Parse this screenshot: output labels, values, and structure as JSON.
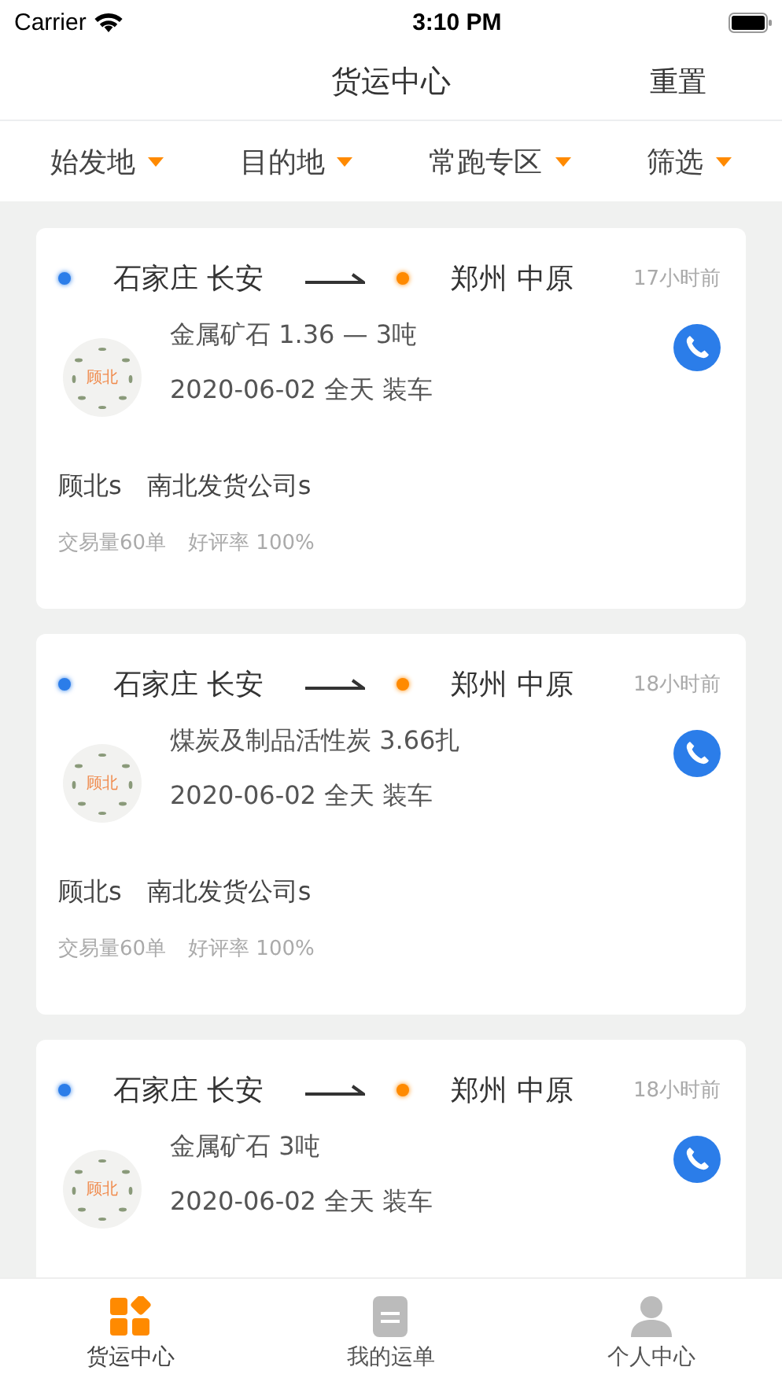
{
  "status_bar": {
    "carrier": "Carrier",
    "time": "3:10 PM"
  },
  "nav": {
    "title": "货运中心",
    "action": "重置"
  },
  "filters": [
    {
      "label": "始发地"
    },
    {
      "label": "目的地"
    },
    {
      "label": "常跑专区"
    },
    {
      "label": "筛选"
    }
  ],
  "cards": [
    {
      "origin": "石家庄 长安",
      "destination": "郑州 中原",
      "time": "17小时前",
      "logo": "顾北",
      "goods": "金属矿石 1.36 — 3吨",
      "loading": "2020-06-02 全天 装车",
      "company": "顾北s　南北发货公司s",
      "stats": [
        "交易量60单",
        "好评率 100%"
      ]
    },
    {
      "origin": "石家庄 长安",
      "destination": "郑州 中原",
      "time": "18小时前",
      "logo": "顾北",
      "goods": "煤炭及制品活性炭  3.66扎",
      "loading": "2020-06-02 全天 装车",
      "company": "顾北s　南北发货公司s",
      "stats": [
        "交易量60单",
        "好评率 100%"
      ]
    },
    {
      "origin": "石家庄 长安",
      "destination": "郑州 中原",
      "time": "18小时前",
      "logo": "顾北",
      "goods": "金属矿石  3吨",
      "loading": "2020-06-02 全天 装车"
    }
  ],
  "tab_bar": [
    {
      "label": "货运中心",
      "kind": "grid",
      "selected": true
    },
    {
      "label": "我的运单",
      "kind": "document",
      "selected": false
    },
    {
      "label": "个人中心",
      "kind": "person",
      "selected": false
    }
  ]
}
